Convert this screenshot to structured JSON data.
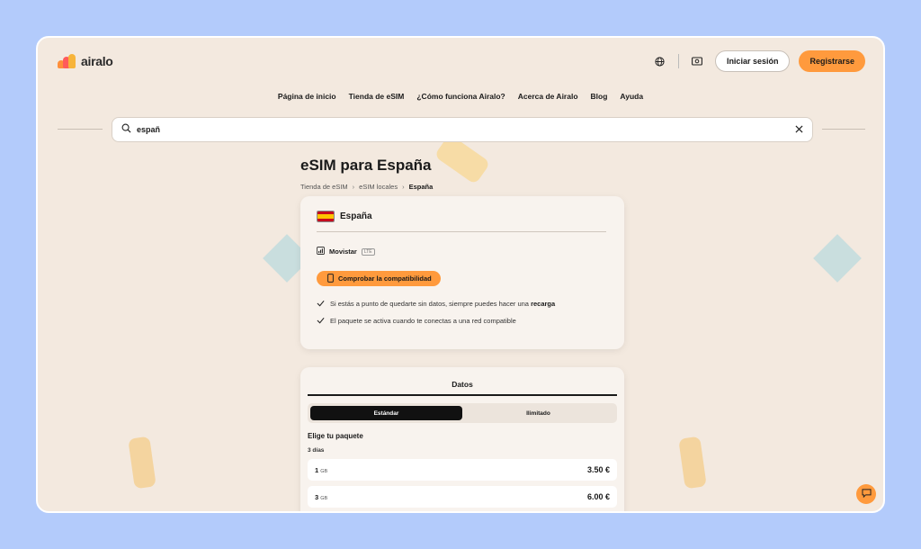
{
  "header": {
    "logo_text": "airalo",
    "login_label": "Iniciar sesión",
    "register_label": "Registrarse"
  },
  "nav": {
    "items": [
      "Página de inicio",
      "Tienda de eSIM",
      "¿Cómo funciona Airalo?",
      "Acerca de Airalo",
      "Blog",
      "Ayuda"
    ]
  },
  "search": {
    "value": "españ"
  },
  "page": {
    "title": "eSIM para España",
    "breadcrumb": [
      "Tienda de eSIM",
      "eSIM locales",
      "España"
    ]
  },
  "country_card": {
    "country": "España",
    "network": "Movistar",
    "network_tech": "LTE",
    "compat_button": "Comprobar la compatibilidad",
    "bullet1_text": "Si estás a punto de quedarte sin datos, siempre puedes hacer una ",
    "bullet1_bold": "recarga",
    "bullet2_text": "El paquete se activa cuando te conectas a una red compatible"
  },
  "plans": {
    "tab_label": "Datos",
    "segment_standard": "Estándar",
    "segment_unlimited": "Ilimitado",
    "heading": "Elige tu paquete",
    "duration": "3 días",
    "items": [
      {
        "amount": "1",
        "unit": "GB",
        "price": "3.50 €"
      },
      {
        "amount": "3",
        "unit": "GB",
        "price": "6.00 €"
      }
    ]
  },
  "colors": {
    "accent": "#ff9a3d",
    "page_bg": "#f3e9df",
    "outer_bg": "#b3cbfb"
  },
  "icons": [
    "globe-icon",
    "currency-icon",
    "search-icon",
    "close-icon",
    "phone-icon",
    "check-icon",
    "signal-icon",
    "chat-icon"
  ]
}
